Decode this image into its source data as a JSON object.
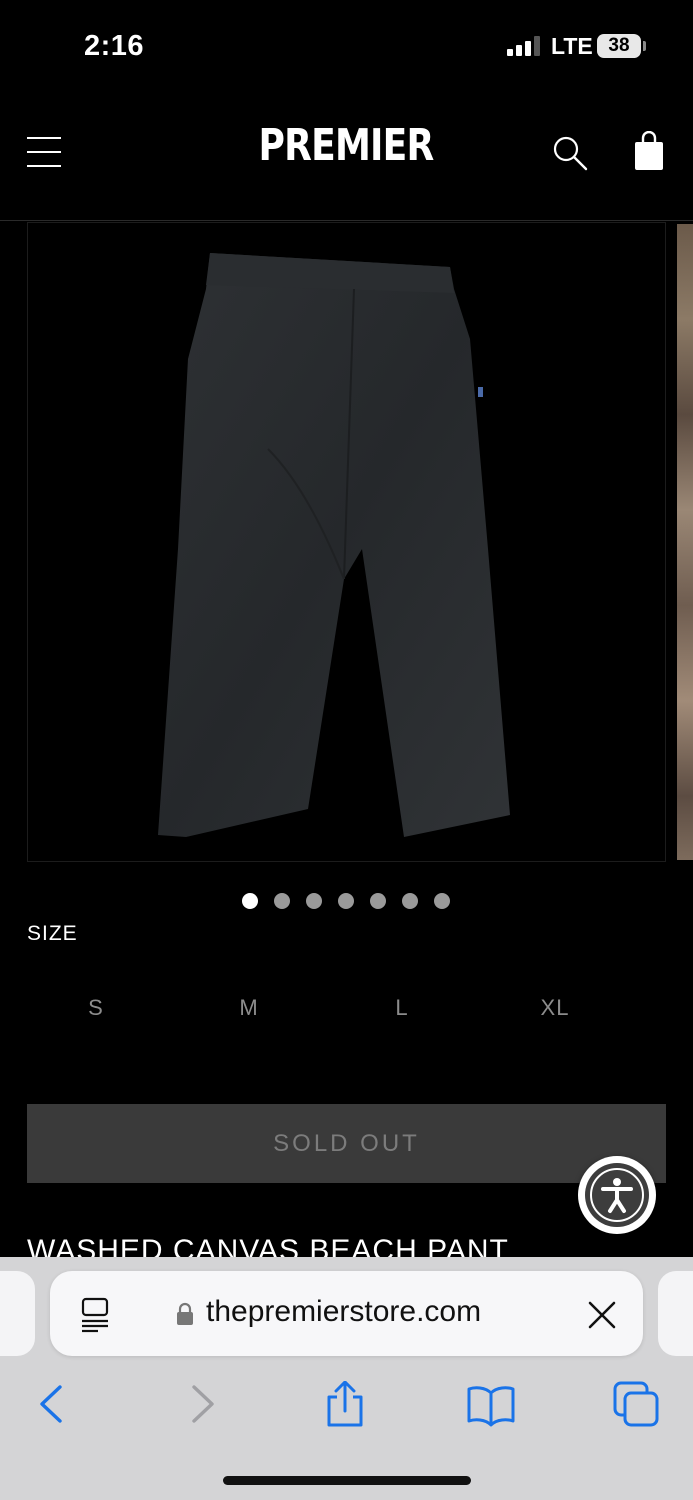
{
  "status_bar": {
    "time": "2:16",
    "network": "LTE",
    "battery": "38"
  },
  "header": {
    "logo": "PREMIER"
  },
  "gallery": {
    "image": "washed-canvas-pants-photo",
    "slide_count": 7,
    "active_slide": 1
  },
  "size": {
    "label": "SIZE",
    "options": [
      "S",
      "M",
      "L",
      "XL"
    ]
  },
  "buy_button": {
    "label": "SOLD OUT"
  },
  "product": {
    "title": "WASHED CANVAS BEACH PANT"
  },
  "browser": {
    "url": "thepremierstore.com"
  },
  "icons": {
    "menu": "hamburger-icon",
    "search": "search-icon",
    "cart": "shopping-bag-icon",
    "accessibility": "accessibility-icon",
    "reader": "reader-mode-icon",
    "lock": "lock-icon",
    "clear": "close-icon",
    "back": "chevron-left-icon",
    "forward": "chevron-right-icon",
    "share": "share-icon",
    "bookmarks": "book-icon",
    "tabs": "tabs-icon"
  },
  "colors": {
    "background": "#000000",
    "button_disabled": "#3a3a3a",
    "safari_accent": "#1a73e8"
  }
}
